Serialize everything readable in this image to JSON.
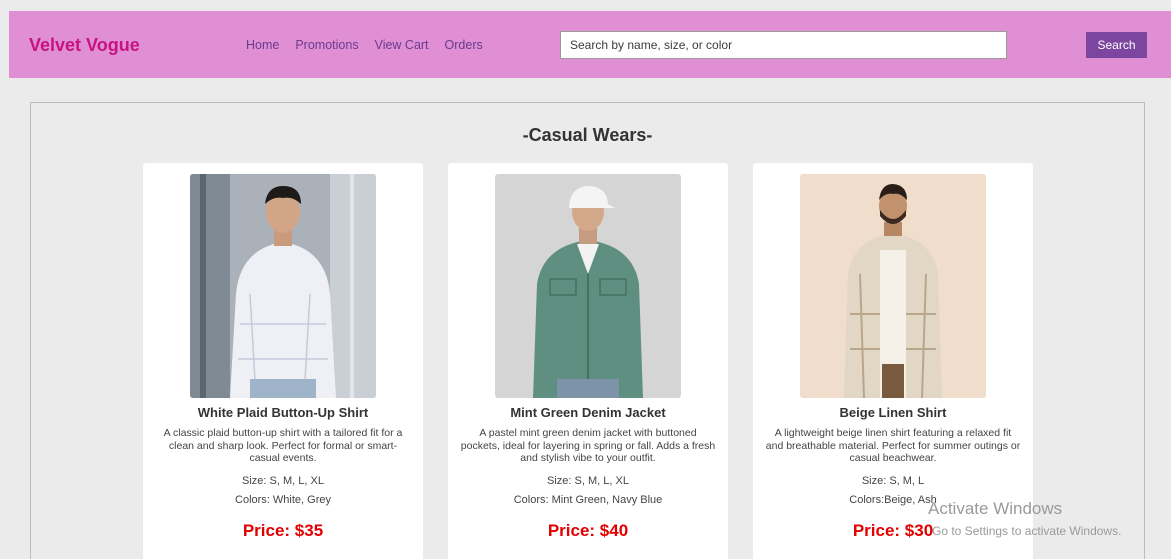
{
  "header": {
    "brand": "Velvet Vogue",
    "nav": [
      "Home",
      "Promotions",
      "View Cart",
      "Orders"
    ],
    "search_placeholder": "Search by name, size, or color",
    "search_button": "Search"
  },
  "colors": {
    "header_bg": "#e08fd5",
    "brand": "#c8127f",
    "nav_link": "#6a3a8e",
    "button_bg": "#7c459f",
    "price": "#e30000"
  },
  "section": {
    "title": "-Casual Wears-"
  },
  "products": [
    {
      "name": "White Plaid Button-Up Shirt",
      "description": "A classic plaid button-up shirt with a tailored fit for a clean and sharp look. Perfect for formal or smart-casual events.",
      "size": "Size: S, M, L, XL",
      "colors": "Colors: White, Grey",
      "price": "Price: $35",
      "image_icon": "man-white-shirt-photo"
    },
    {
      "name": "Mint Green Denim Jacket",
      "description": "A pastel mint green denim jacket with buttoned pockets, ideal for layering in spring or fall. Adds a fresh and stylish vibe to your outfit.",
      "size": "Size: S, M, L, XL",
      "colors": "Colors: Mint Green, Navy Blue",
      "price": "Price: $40",
      "image_icon": "man-denim-jacket-photo"
    },
    {
      "name": "Beige Linen Shirt",
      "description": "A lightweight beige linen shirt featuring a relaxed fit and breathable material. Perfect for summer outings or casual beachwear.",
      "size": "Size: S, M, L",
      "colors": "Colors:Beige, Ash",
      "price": "Price: $30",
      "image_icon": "man-linen-shirt-photo"
    }
  ],
  "watermark": {
    "line1": "Activate Windows",
    "line2": "Go to Settings to activate Windows."
  }
}
